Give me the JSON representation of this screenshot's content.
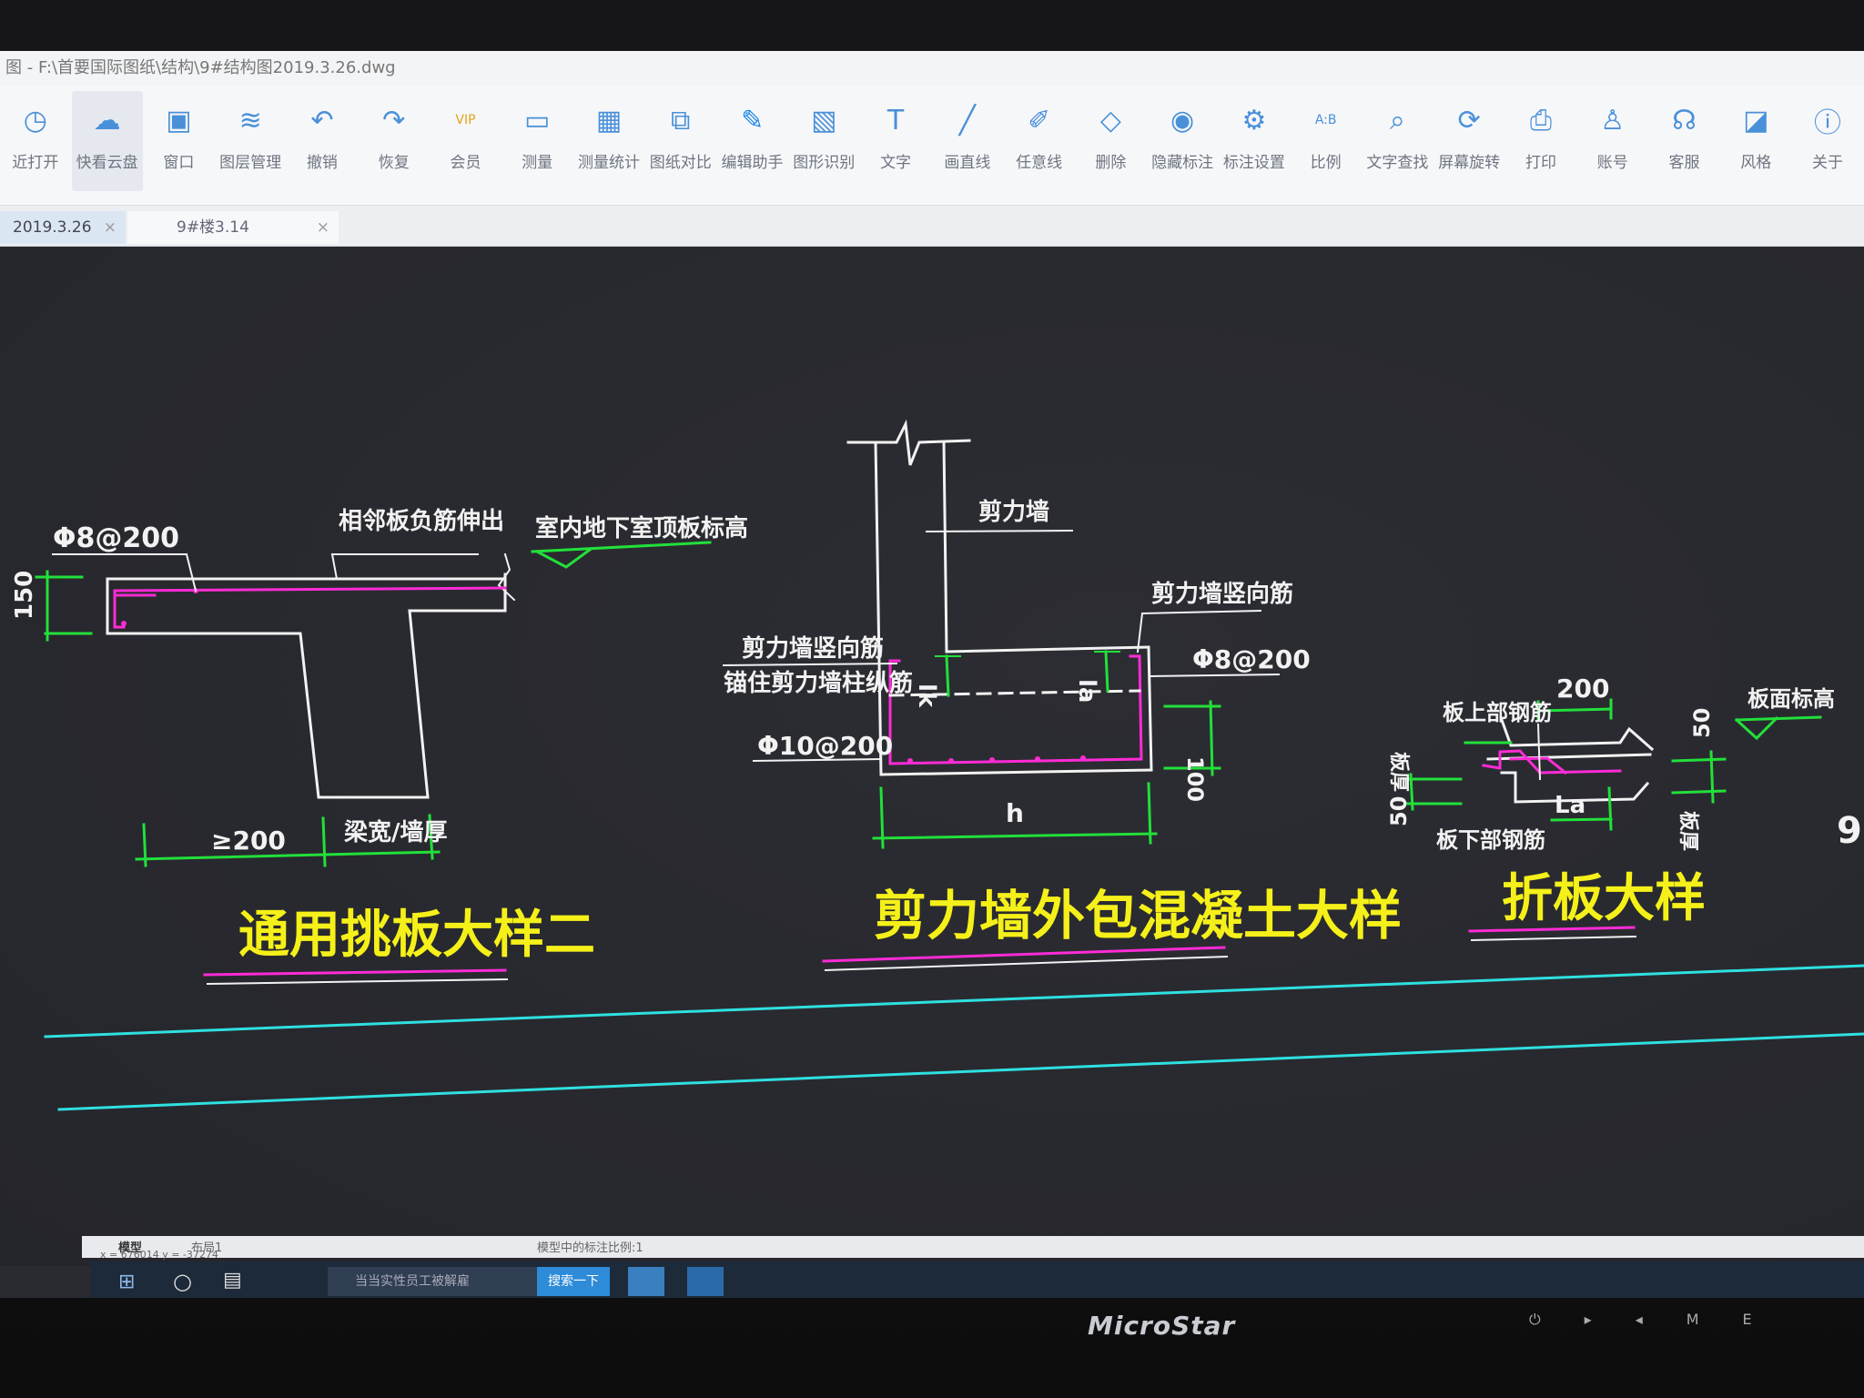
{
  "window_title": "图 - F:\\首要国际图纸\\结构\\9#结构图2019.3.26.dwg",
  "toolbar": [
    {
      "label": "近打开",
      "icon": "clock-icon"
    },
    {
      "label": "快看云盘",
      "icon": "cloud-icon"
    },
    {
      "label": "窗口",
      "icon": "window-icon"
    },
    {
      "label": "图层管理",
      "icon": "layers-icon"
    },
    {
      "label": "撤销",
      "icon": "undo-icon"
    },
    {
      "label": "恢复",
      "icon": "redo-icon"
    },
    {
      "label": "会员",
      "icon": "vip-icon"
    },
    {
      "label": "测量",
      "icon": "ruler-icon"
    },
    {
      "label": "测量统计",
      "icon": "measure-stats-icon"
    },
    {
      "label": "图纸对比",
      "icon": "compare-icon"
    },
    {
      "label": "编辑助手",
      "icon": "edit-assistant-icon"
    },
    {
      "label": "图形识别",
      "icon": "shape-recognize-icon"
    },
    {
      "label": "文字",
      "icon": "text-icon"
    },
    {
      "label": "画直线",
      "icon": "line-icon"
    },
    {
      "label": "任意线",
      "icon": "freehand-icon"
    },
    {
      "label": "删除",
      "icon": "eraser-icon"
    },
    {
      "label": "隐藏标注",
      "icon": "hide-annotation-icon"
    },
    {
      "label": "标注设置",
      "icon": "annotation-settings-icon"
    },
    {
      "label": "比例",
      "icon": "scale-icon"
    },
    {
      "label": "文字查找",
      "icon": "text-search-icon"
    },
    {
      "label": "屏幕旋转",
      "icon": "rotate-screen-icon"
    },
    {
      "label": "打印",
      "icon": "print-icon"
    },
    {
      "label": "账号",
      "icon": "account-icon"
    },
    {
      "label": "客服",
      "icon": "headset-icon"
    },
    {
      "label": "风格",
      "icon": "style-icon"
    },
    {
      "label": "关于",
      "icon": "about-icon"
    }
  ],
  "tabs": [
    {
      "label": "2019.3.26",
      "close": "×"
    },
    {
      "label": "9#楼3.14",
      "close": "×"
    }
  ],
  "drawing": {
    "detail1": {
      "title": "通用挑板大样二",
      "rebar": "Φ8@200",
      "note1": "相邻板负筋伸出",
      "note2": "室内地下室顶板标高",
      "dim_h": "150",
      "dim_a": "≥200",
      "dim_b": "梁宽/墙厚"
    },
    "detail2": {
      "title": "剪力墙外包混凝土大样",
      "wall": "剪力墙",
      "wall_vbar_r": "剪力墙竖向筋",
      "wall_vbar_l": "剪力墙竖向筋",
      "wall_col": "锚住剪力墙柱纵筋",
      "rebar_r": "Φ8@200",
      "rebar_b": "Φ10@200",
      "lk": "lk",
      "la": "la",
      "dim_100": "100",
      "dim_h": "h"
    },
    "detail3": {
      "title": "折板大样",
      "top_bar": "板上部钢筋",
      "bot_bar": "板下部钢筋",
      "dim_200": "200",
      "dim_la": "La",
      "dim_50a": "50",
      "dim_50b": "50",
      "elev": "板面标高",
      "thick_l": "板厚",
      "thick_r": "板厚"
    },
    "edge_text": "9."
  },
  "status": {
    "layout_tabs": [
      "模型",
      "布局1"
    ],
    "scale_text": "模型中的标注比例:1",
    "coords": "x = 676014  y = -37274"
  },
  "taskbar": {
    "search_text": "当当实性员工被解雇",
    "search_button": "搜索一下"
  },
  "monitor": {
    "brand": "MicroStar",
    "buttons": [
      "⏻",
      "▸",
      "◂",
      "M",
      "E"
    ]
  },
  "colors": {
    "cad_white": "#f2f2f2",
    "cad_green": "#22e03a",
    "cad_magenta": "#ff2bd6",
    "cad_yellow": "#f5f019",
    "cad_cyan": "#2fe0e0",
    "toolbar_bg": "#f6f7f9"
  }
}
